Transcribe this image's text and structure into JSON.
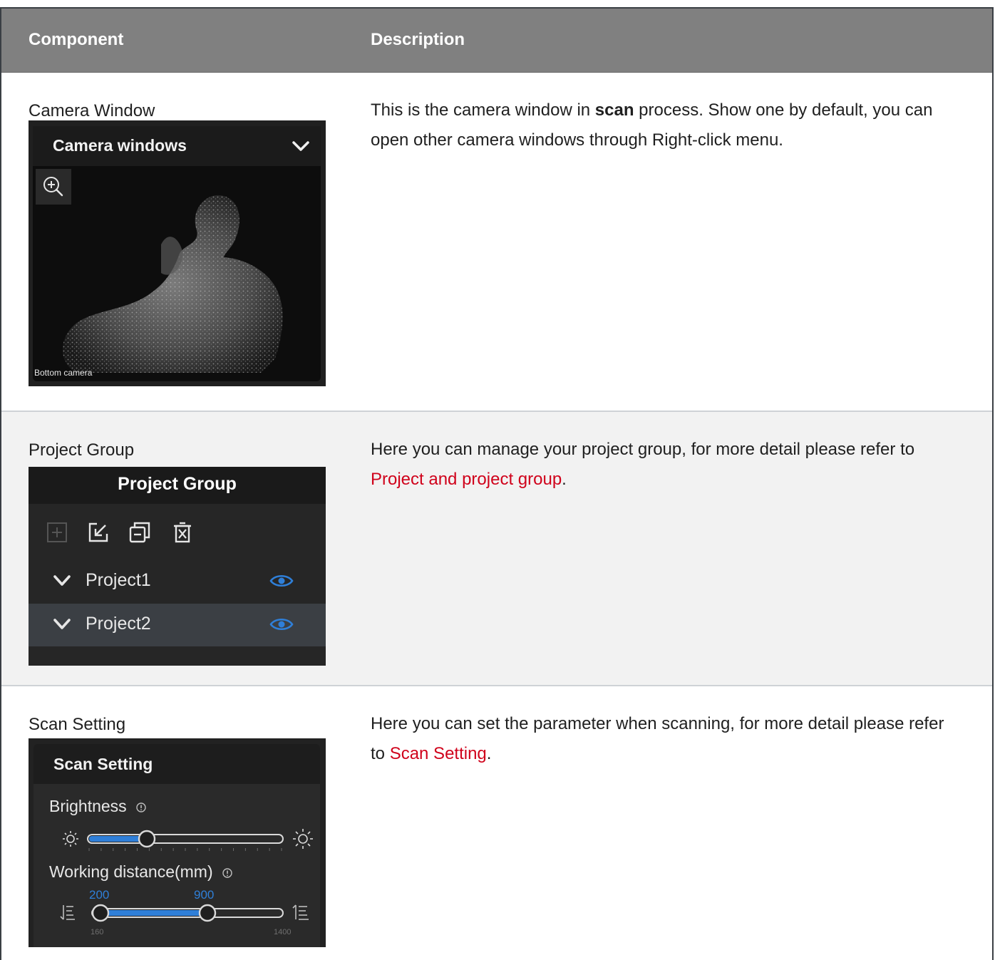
{
  "table": {
    "headers": {
      "component": "Component",
      "description": "Description"
    },
    "rows": [
      {
        "component": "Camera Window",
        "desc_pre": "This is the camera window in ",
        "desc_bold": "scan",
        "desc_post": " process. Show one by default, you can open other camera windows through Right-click menu.",
        "shot": {
          "title": "Camera windows",
          "caption": "Bottom camera",
          "zoom_icon": "zoom-in-icon",
          "chevron_icon": "chevron-down-icon"
        }
      },
      {
        "component": "Project Group",
        "desc_pre": "Here you can manage your project group, for more detail please refer to ",
        "desc_link": "Project and project group",
        "desc_post": ".",
        "shot": {
          "title": "Project Group",
          "tools": [
            "add-icon",
            "import-icon",
            "collapse-icon",
            "delete-icon"
          ],
          "items": [
            {
              "name": "Project1"
            },
            {
              "name": "Project2"
            }
          ]
        }
      },
      {
        "component": "Scan Setting",
        "desc_pre": "Here you can set the parameter when scanning, for more detail please refer to ",
        "desc_link": "Scan Setting",
        "desc_post": ".",
        "shot": {
          "title": "Scan Setting",
          "brightness_label": "Brightness",
          "brightness_level": 0.3,
          "distance_label": "Working distance(mm)",
          "distance_min": "160",
          "distance_max": "1400",
          "distance_low": "200",
          "distance_high": "900"
        }
      }
    ]
  },
  "colors": {
    "header_bg": "#808080",
    "link": "#d0021b",
    "accent": "#2f7fd8",
    "alt_row": "#f2f2f2"
  }
}
